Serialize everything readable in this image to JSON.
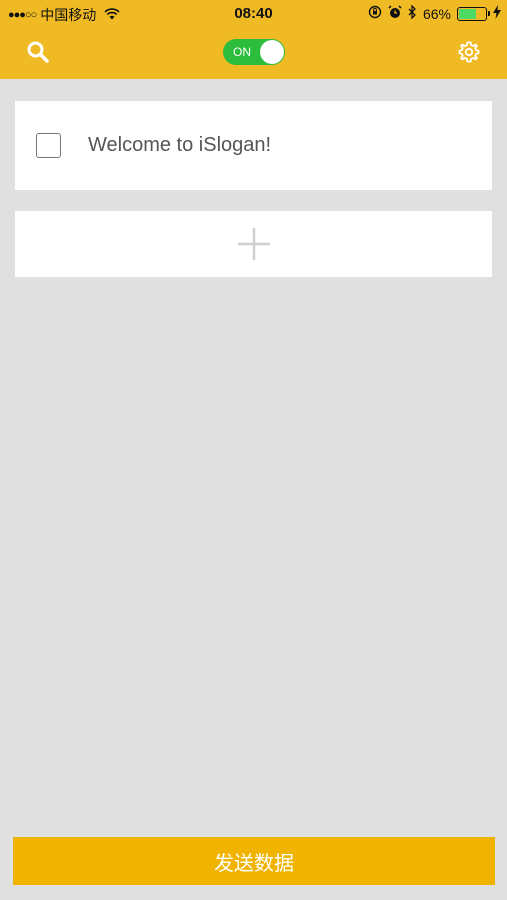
{
  "status_bar": {
    "signal_dots": "●●●○○",
    "carrier": "中国移动",
    "time": "08:40",
    "battery_percent": "66%",
    "battery_level": 0.66
  },
  "header": {
    "toggle_label": "ON",
    "toggle_on": true
  },
  "items": [
    {
      "text": "Welcome to iSlogan!",
      "checked": false
    }
  ],
  "footer": {
    "send_label": "发送数据"
  },
  "colors": {
    "header_bg": "#f0ba25",
    "toggle_bg": "#2dbd3c",
    "send_button_bg": "#f0b300",
    "page_bg": "#e0e0e0"
  }
}
